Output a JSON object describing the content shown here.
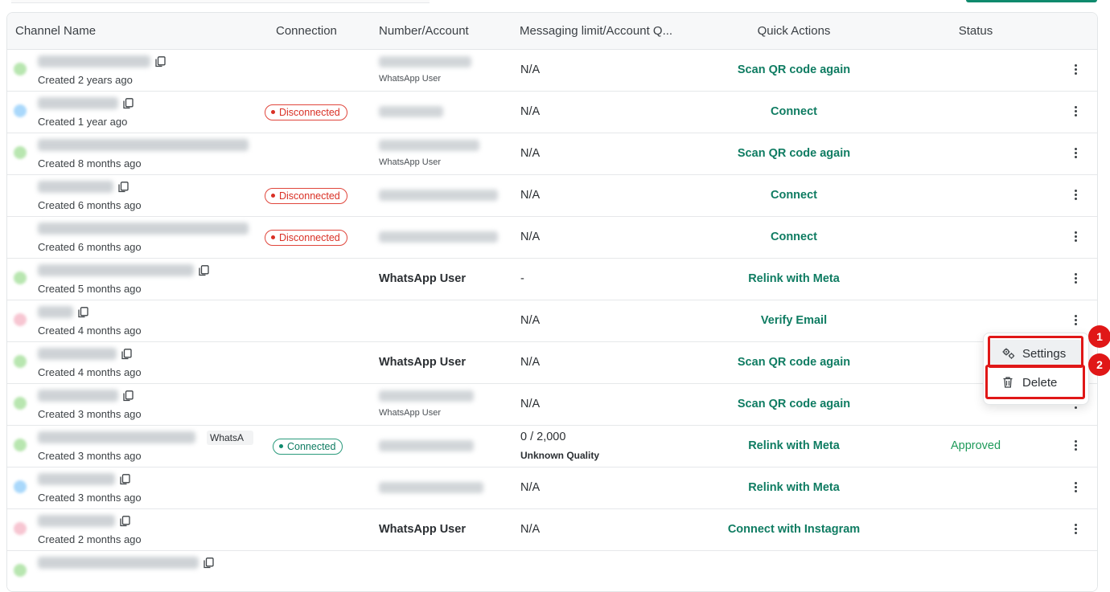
{
  "header": {
    "columns": [
      "Channel Name",
      "Connection",
      "Number/Account",
      "Messaging limit/Account Q...",
      "Quick Actions",
      "Status"
    ]
  },
  "rows": [
    {
      "created": "Created 2 years ago",
      "avatar_color": "#b8e6b0",
      "name_w": 140,
      "copy": true,
      "connection": "",
      "num": "blur",
      "num_sub": "WhatsApp User",
      "messaging": "N/A",
      "action": "Scan QR code again",
      "status": ""
    },
    {
      "created": "Created 1 year ago",
      "avatar_color": "#a9d8fb",
      "name_w": 100,
      "copy": true,
      "connection": "Disconnected",
      "num": "blur",
      "num_sub": "",
      "messaging": "N/A",
      "action": "Connect",
      "status": ""
    },
    {
      "created": "Created 8 months ago",
      "avatar_color": "#b8e6b0",
      "name_w": 262,
      "copy": false,
      "connection": "",
      "num": "blur",
      "num_sub": "WhatsApp User",
      "messaging": "N/A",
      "action": "Scan QR code again",
      "status": ""
    },
    {
      "created": "Created 6 months ago",
      "avatar_color": "",
      "name_w": 94,
      "copy": true,
      "connection": "Disconnected",
      "num": "blur",
      "num_sub": "",
      "messaging": "N/A",
      "action": "Connect",
      "status": ""
    },
    {
      "created": "Created 6 months ago",
      "avatar_color": "",
      "name_w": 262,
      "copy": false,
      "connection": "Disconnected",
      "num": "blur",
      "num_sub": "",
      "messaging": "N/A",
      "action": "Connect",
      "status": ""
    },
    {
      "created": "Created 5 months ago",
      "avatar_color": "#b8e6b0",
      "name_w": 194,
      "copy": true,
      "connection": "",
      "num": "WhatsApp User",
      "num_sub": "",
      "messaging": "-",
      "action": "Relink with Meta",
      "status": ""
    },
    {
      "created": "Created 4 months ago",
      "avatar_color": "#f7c6d2",
      "name_w": 44,
      "copy": true,
      "connection": "",
      "num": "",
      "num_sub": "",
      "messaging": "N/A",
      "action": "Verify Email",
      "status": ""
    },
    {
      "created": "Created 4 months ago",
      "avatar_color": "#b8e6b0",
      "name_w": 98,
      "copy": true,
      "connection": "",
      "num": "WhatsApp User",
      "num_sub": "",
      "messaging": "N/A",
      "action": "Scan QR code again",
      "status": ""
    },
    {
      "created": "Created 3 months ago",
      "avatar_color": "#b8e6b0",
      "name_w": 100,
      "copy": true,
      "connection": "",
      "num": "blur",
      "num_sub": "WhatsApp User",
      "messaging": "N/A",
      "action": "Scan QR code again",
      "status": ""
    },
    {
      "created": "Created 3 months ago",
      "avatar_color": "#b8e6b0",
      "name_w": 196,
      "copy": false,
      "tag": "WhatsA",
      "connection": "Connected",
      "num": "blur",
      "num_sub": "",
      "messaging": "0 / 2,000",
      "messaging_sub": "Unknown Quality",
      "action": "Relink with Meta",
      "status": "Approved"
    },
    {
      "created": "Created 3 months ago",
      "avatar_color": "#a9d8fb",
      "name_w": 96,
      "copy": true,
      "connection": "",
      "num": "blur",
      "num_sub": "",
      "messaging": "N/A",
      "action": "Relink with Meta",
      "status": ""
    },
    {
      "created": "Created 2 months ago",
      "avatar_color": "#f7c6d2",
      "name_w": 96,
      "copy": true,
      "connection": "",
      "num": "WhatsApp User",
      "num_sub": "",
      "messaging": "N/A",
      "action": "Connect with Instagram",
      "status": ""
    },
    {
      "created": "",
      "avatar_color": "#b8e6b0",
      "name_w": 200,
      "copy": true,
      "connection": "",
      "num": "",
      "num_sub": "",
      "messaging": "",
      "action": "",
      "status": ""
    }
  ],
  "menu": {
    "settings_label": "Settings",
    "delete_label": "Delete"
  },
  "annotations": [
    "1",
    "2"
  ],
  "colors": {
    "accent": "#0f7c62",
    "danger": "#d93025",
    "approved": "#1f9a5a",
    "annotation": "#e01717"
  }
}
